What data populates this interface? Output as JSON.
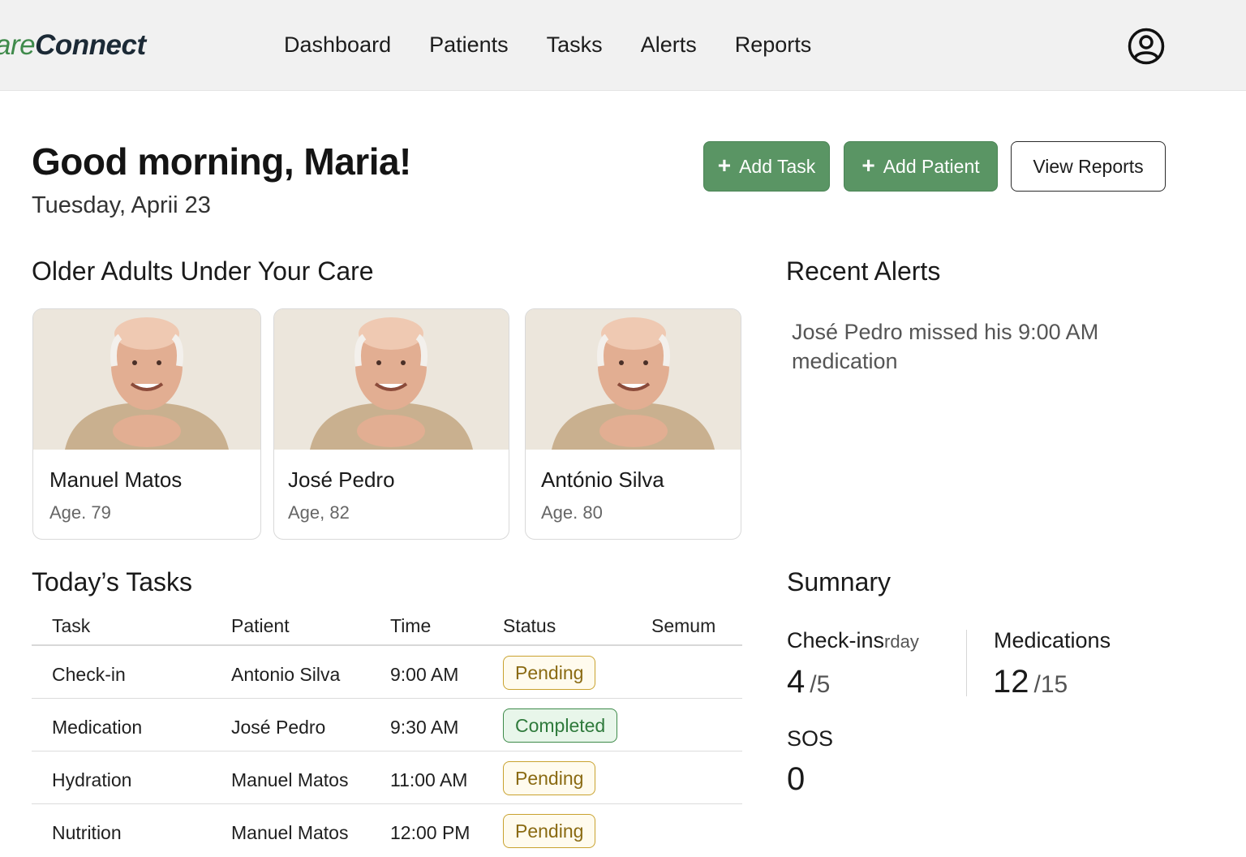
{
  "app": {
    "logo_part1": "are",
    "logo_part2": "Connect"
  },
  "nav": {
    "items": [
      {
        "label": "Dashboard"
      },
      {
        "label": "Patients"
      },
      {
        "label": "Tasks"
      },
      {
        "label": "Alerts"
      },
      {
        "label": "Reports"
      }
    ],
    "profile_icon": "user-circle-icon"
  },
  "header": {
    "greeting": "Good morning, Maria!",
    "date": "Tuesday, Aprii 23",
    "buttons": {
      "add_task": "Add Task",
      "add_patient": "Add Patient",
      "view_reports": "View Reports"
    },
    "plus_glyph": "+"
  },
  "patients": {
    "title": "Older Adults Under Your Care",
    "cards": [
      {
        "name": "Manuel Matos",
        "age": "Age. 79"
      },
      {
        "name": "José Pedro",
        "age": "Age, 82"
      },
      {
        "name": "António Silva",
        "age": "Age. 80"
      }
    ]
  },
  "alerts": {
    "title": "Recent Alerts",
    "items": [
      {
        "text": "José Pedro missed his 9:00 AM medication"
      }
    ]
  },
  "tasks": {
    "title": "Today’s Tasks",
    "columns": [
      "Task",
      "Patient",
      "Time",
      "Status",
      "Semum"
    ],
    "rows": [
      {
        "task": "Check-in",
        "patient": "Antonio Silva",
        "time": "9:00 AM",
        "status": "Pending"
      },
      {
        "task": "Medication",
        "patient": "José Pedro",
        "time": "9:30 AM",
        "status": "Completed"
      },
      {
        "task": "Hydration",
        "patient": "Manuel Matos",
        "time": "11:00 AM",
        "status": "Pending"
      },
      {
        "task": "Nutrition",
        "patient": "Manuel Matos",
        "time": "12:00 PM",
        "status": "Pending"
      }
    ]
  },
  "summary": {
    "title": "Sumnary",
    "checkins": {
      "label": "Check-ins",
      "sublabel": "rday",
      "value": "4",
      "total": "/5"
    },
    "medications": {
      "label": "Medications",
      "value": "12",
      "total": "/15"
    },
    "sos": {
      "label": "SOS",
      "value": "0"
    }
  },
  "colors": {
    "brand_green": "#5a9564",
    "pending": "#c9a22f",
    "completed": "#3d8a49"
  }
}
